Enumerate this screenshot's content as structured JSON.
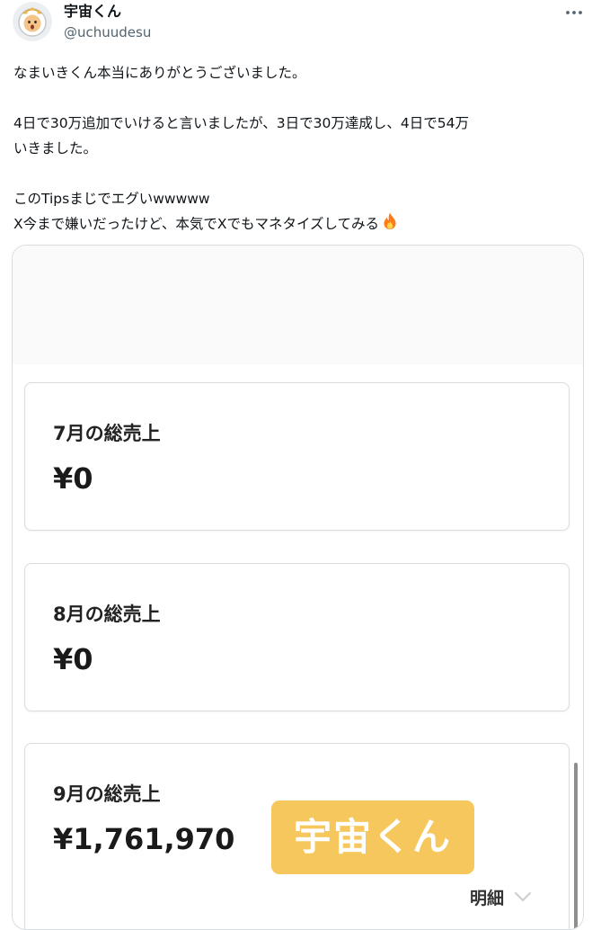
{
  "tweet": {
    "author": {
      "display_name": "宇宙くん",
      "handle": "@uchuudesu",
      "avatar_icon": "astronaut-avatar-icon"
    },
    "more_icon": "more-horizontal-icon",
    "text": {
      "line1": "なまいきくん本当にありがとうございました。",
      "line2": "4日で30万追加でいけると言いましたが、3日で30万達成し、4日で54万",
      "line3": "いきました。",
      "line4": "このTipsまじでエグいwwwww",
      "line5": "X今まで嫌いだったけど、本気でXでもマネタイズしてみる",
      "emoji": "fire-icon"
    }
  },
  "media": {
    "cards": [
      {
        "label": "7月の総売上",
        "amount": "¥0"
      },
      {
        "label": "8月の総売上",
        "amount": "¥0"
      },
      {
        "label": "9月の総売上",
        "amount": "¥1,761,970"
      }
    ],
    "watermark": "宇宙くん",
    "details_label": "明細",
    "details_icon": "chevron-down-icon"
  },
  "colors": {
    "watermark_bg": "#f6c75c",
    "fire": "#ff7a1a",
    "secondary_text": "#536471",
    "border": "#d9dde1"
  }
}
